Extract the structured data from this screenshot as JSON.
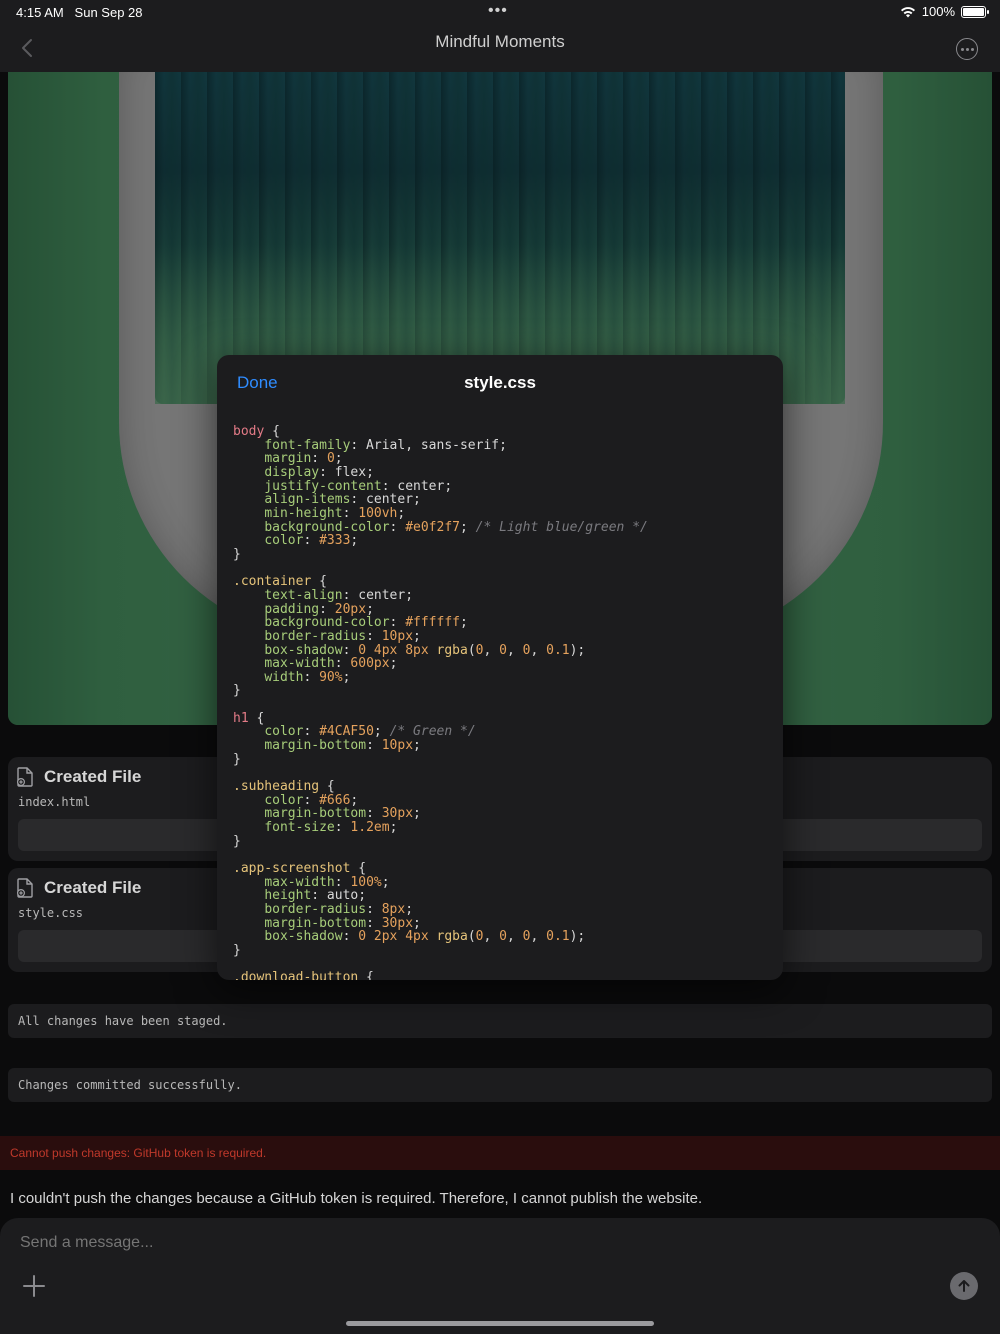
{
  "status": {
    "time": "4:15 AM",
    "date": "Sun Sep 28",
    "dots": "•••",
    "battery": "100%"
  },
  "nav": {
    "title": "Mindful Moments"
  },
  "cards": [
    {
      "title": "Created File",
      "file": "index.html"
    },
    {
      "title": "Created File",
      "file": "style.css"
    }
  ],
  "messages": {
    "staged": "All changes have been staged.",
    "committed": "Changes committed successfully.",
    "error": "Cannot push changes: GitHub token is required.",
    "assistant": "I couldn't push the changes because a GitHub token is required. Therefore, I cannot publish the website."
  },
  "composer": {
    "placeholder": "Send a message..."
  },
  "modal": {
    "done_label": "Done",
    "title": "style.css",
    "code_lines": [
      "body {",
      "    font-family: Arial, sans-serif;",
      "    margin: 0;",
      "    display: flex;",
      "    justify-content: center;",
      "    align-items: center;",
      "    min-height: 100vh;",
      "    background-color: #e0f2f7; /* Light blue/green */",
      "    color: #333;",
      "}",
      "",
      ".container {",
      "    text-align: center;",
      "    padding: 20px;",
      "    background-color: #ffffff;",
      "    border-radius: 10px;",
      "    box-shadow: 0 4px 8px rgba(0, 0, 0, 0.1);",
      "    max-width: 600px;",
      "    width: 90%;",
      "}",
      "",
      "h1 {",
      "    color: #4CAF50; /* Green */",
      "    margin-bottom: 10px;",
      "}",
      "",
      ".subheading {",
      "    color: #666;",
      "    margin-bottom: 30px;",
      "    font-size: 1.2em;",
      "}",
      "",
      ".app-screenshot {",
      "    max-width: 100%;",
      "    height: auto;",
      "    border-radius: 8px;",
      "    margin-bottom: 30px;",
      "    box-shadow: 0 2px 4px rgba(0, 0, 0, 0.1);",
      "}",
      "",
      ".download-button {"
    ]
  },
  "colors": {
    "accent": "#2f8cff",
    "error": "#c0392b",
    "preview_green": "#57a472"
  }
}
